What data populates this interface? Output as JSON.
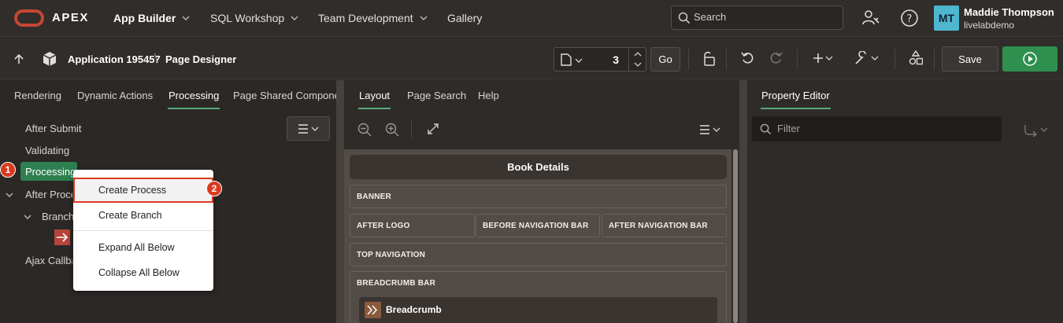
{
  "header": {
    "brand": "APEX",
    "nav": [
      {
        "label": "App Builder"
      },
      {
        "label": "SQL Workshop"
      },
      {
        "label": "Team Development"
      },
      {
        "label": "Gallery"
      }
    ],
    "search_placeholder": "Search",
    "user": {
      "initials": "MT",
      "name": "Maddie Thompson",
      "workspace": "livelabdemo"
    }
  },
  "toolbar": {
    "breadcrumb": [
      "Application 195457",
      "Page Designer"
    ],
    "page_number": "3",
    "go_label": "Go",
    "save_label": "Save"
  },
  "left_panel": {
    "tabs": [
      "Rendering",
      "Dynamic Actions",
      "Processing",
      "Page Shared Components"
    ],
    "active_tab": "Processing",
    "tree": {
      "after_submit": "After Submit",
      "validating": "Validating",
      "processing": "Processing",
      "after_processing": "After Processing",
      "branches": "Branches",
      "ajax_callback": "Ajax Callback"
    },
    "context_menu": [
      "Create Process",
      "Create Branch",
      "Expand All Below",
      "Collapse All Below"
    ],
    "callouts": [
      "1",
      "2"
    ]
  },
  "middle_panel": {
    "tabs": [
      "Layout",
      "Page Search",
      "Help"
    ],
    "active_tab": "Layout",
    "page_title": "Book Details",
    "regions": {
      "banner": "BANNER",
      "after_logo": "AFTER LOGO",
      "before_nav": "BEFORE NAVIGATION BAR",
      "after_nav": "AFTER NAVIGATION BAR",
      "top_nav": "TOP NAVIGATION",
      "breadcrumb_bar": "BREADCRUMB BAR",
      "breadcrumb": "Breadcrumb"
    }
  },
  "right_panel": {
    "tabs": [
      "Property Editor"
    ],
    "filter_placeholder": "Filter"
  },
  "colors": {
    "accent_green": "#2f8050",
    "callout_red": "#d93a1f",
    "oracle_red": "#c74634"
  }
}
